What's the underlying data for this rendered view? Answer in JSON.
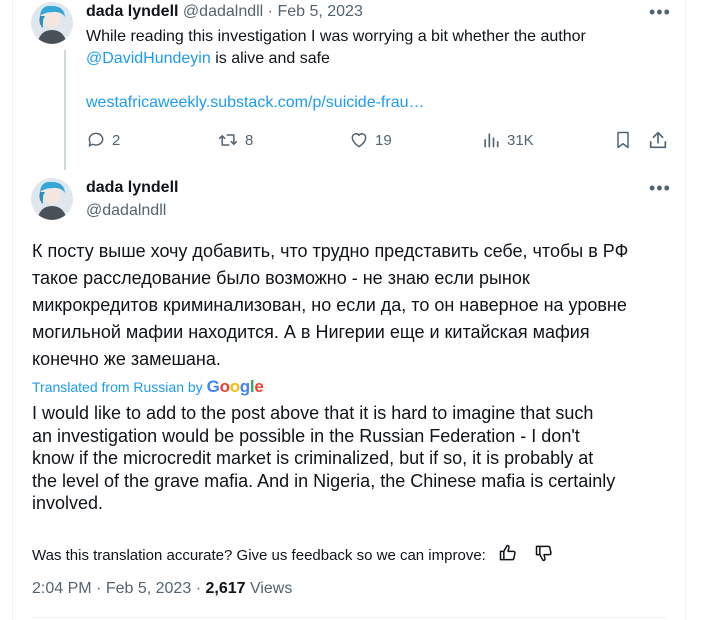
{
  "reply_tweet": {
    "author_name": "dada lyndell",
    "handle": "@dadalndll",
    "separator": "·",
    "date": "Feb 5, 2023",
    "text_line1": "While reading this investigation I was worrying a bit whether the author",
    "mention": "@DavidHundeyin",
    "text_line2_rest": " is alive and safe",
    "url": "westafricaweekly.substack.com/p/suicide-frau…",
    "actions": {
      "replies": "2",
      "retweets": "8",
      "likes": "19",
      "views": "31K"
    }
  },
  "main_tweet": {
    "author_name": "dada lyndell",
    "handle": "@dadalndll",
    "original_lines": [
      "К посту выше хочу добавить, что трудно представить себе, чтобы в РФ",
      "такое расследование было возможно - не знаю если рынок",
      "микрокредитов криминализован, но если да, то он наверное на уровне",
      "могильной мафии находится. А в Нигерии еще и китайская мафия",
      "конечно же замешана."
    ],
    "translated_from": "Translated from Russian by",
    "google_brand": "Google",
    "translation_lines": [
      "I would like to add to the post above that it is hard to imagine that such",
      "an investigation would be possible in the Russian Federation - I don't",
      "know if the microcredit market is criminalized, but if so, it is probably at",
      "the level of the grave mafia. And in Nigeria, the Chinese mafia is certainly",
      "involved."
    ],
    "feedback_prompt": "Was this translation accurate? Give us feedback so we can improve:",
    "time": "2:04 PM",
    "dot": "·",
    "date": "Feb 5, 2023",
    "views_count": "2,617",
    "views_label": "Views"
  },
  "colors": {
    "link": "#1d9bf0",
    "muted": "#536471",
    "text": "#0f1419"
  }
}
